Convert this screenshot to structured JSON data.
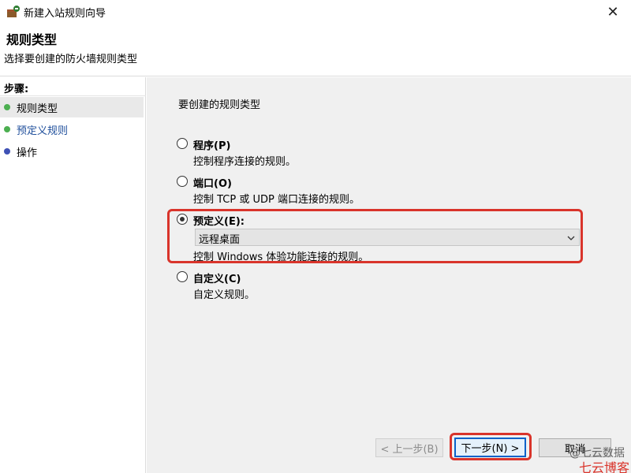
{
  "window": {
    "title": "新建入站规则向导",
    "close_label": "✕"
  },
  "header": {
    "title": "规则类型",
    "subtitle": "选择要创建的防火墙规则类型"
  },
  "sidebar": {
    "steps_label": "步骤:",
    "steps": [
      {
        "label": "规则类型",
        "dot_color": "#4caf50"
      },
      {
        "label": "预定义规则",
        "dot_color": "#4caf50"
      },
      {
        "label": "操作",
        "dot_color": "#3f51b5"
      }
    ]
  },
  "main": {
    "question": "要创建的规则类型",
    "options": [
      {
        "label": "程序(P)",
        "desc": "控制程序连接的规则。",
        "checked": false
      },
      {
        "label": "端口(O)",
        "desc": "控制 TCP 或 UDP 端口连接的规则。",
        "checked": false
      },
      {
        "label": "预定义(E):",
        "desc": "控制 Windows 体验功能连接的规则。",
        "checked": true
      },
      {
        "label": "自定义(C)",
        "desc": "自定义规则。",
        "checked": false
      }
    ],
    "predefined_select": {
      "value": "远程桌面"
    }
  },
  "buttons": {
    "back": "< 上一步(B)",
    "next": "下一步(N) >",
    "cancel": "取消"
  },
  "watermark": {
    "line1": "@七云数据",
    "line2": "七云博客"
  },
  "colors": {
    "highlight": "#d9342b",
    "link": "#1e4e9b",
    "primary_border": "#0a62c9"
  }
}
